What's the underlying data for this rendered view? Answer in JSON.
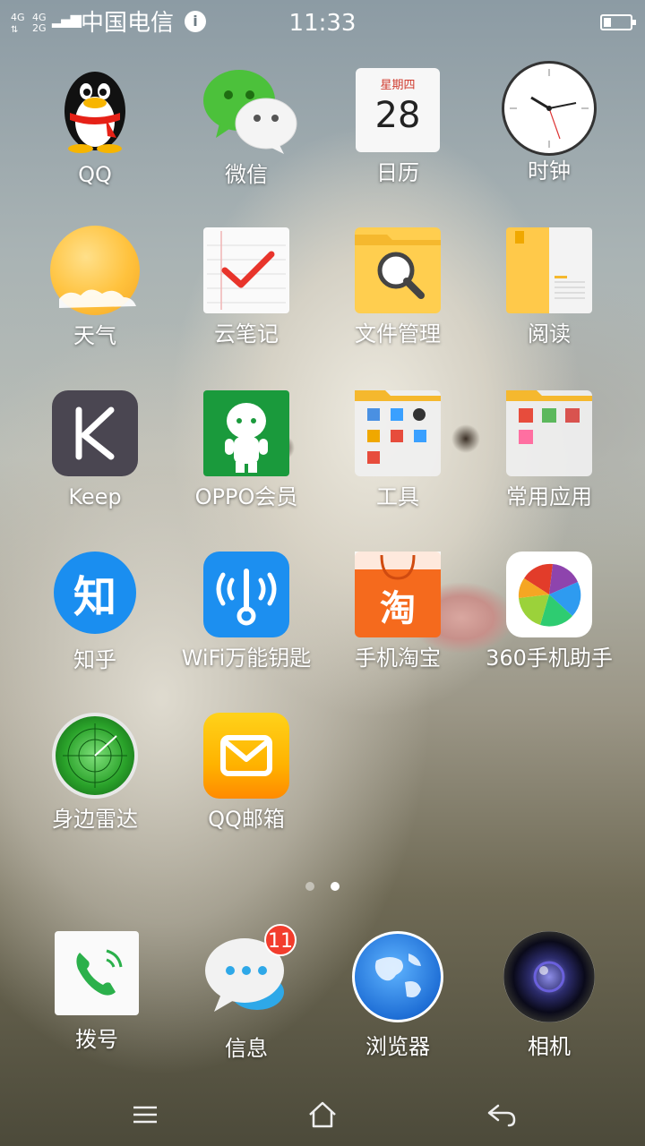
{
  "status_bar": {
    "signal_top_1": "4G",
    "signal_top_2": "4G",
    "signal_bottom_2": "2G",
    "carrier": "中国电信",
    "time": "11:33"
  },
  "apps": [
    {
      "label": "QQ",
      "icon": "qq-penguin-icon"
    },
    {
      "label": "微信",
      "icon": "wechat-icon"
    },
    {
      "label": "日历",
      "icon": "calendar-icon",
      "weekday": "星期四",
      "day": "28"
    },
    {
      "label": "时钟",
      "icon": "clock-icon"
    },
    {
      "label": "天气",
      "icon": "weather-icon"
    },
    {
      "label": "云笔记",
      "icon": "notes-icon"
    },
    {
      "label": "文件管理",
      "icon": "file-manager-icon"
    },
    {
      "label": "阅读",
      "icon": "reader-icon"
    },
    {
      "label": "Keep",
      "icon": "keep-icon"
    },
    {
      "label": "OPPO会员",
      "icon": "oppo-member-icon"
    },
    {
      "label": "工具",
      "icon": "tools-folder-icon"
    },
    {
      "label": "常用应用",
      "icon": "common-apps-folder-icon"
    },
    {
      "label": "知乎",
      "icon": "zhihu-icon",
      "glyph": "知"
    },
    {
      "label": "WiFi万能钥匙",
      "icon": "wifi-key-icon"
    },
    {
      "label": "手机淘宝",
      "icon": "taobao-icon",
      "glyph": "淘"
    },
    {
      "label": "360手机助手",
      "icon": "app360-icon"
    },
    {
      "label": "身边雷达",
      "icon": "radar-icon"
    },
    {
      "label": "QQ邮箱",
      "icon": "qq-mail-icon"
    }
  ],
  "dock": [
    {
      "label": "拨号",
      "icon": "phone-icon"
    },
    {
      "label": "信息",
      "icon": "messages-icon",
      "badge": "11"
    },
    {
      "label": "浏览器",
      "icon": "browser-icon"
    },
    {
      "label": "相机",
      "icon": "camera-icon"
    }
  ],
  "page_indicator": {
    "pages": 2,
    "current": 2
  },
  "nav": [
    "menu-icon",
    "home-icon",
    "back-icon"
  ]
}
